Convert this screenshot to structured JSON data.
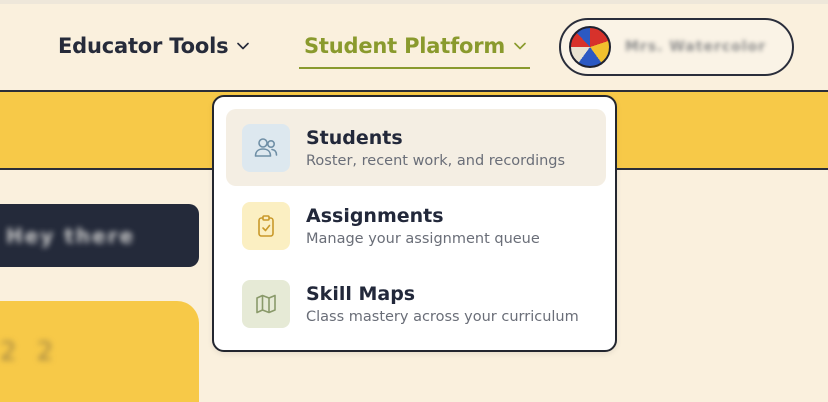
{
  "header": {
    "nav": [
      {
        "label": "Educator Tools",
        "active": false
      },
      {
        "label": "Student Platform",
        "active": true
      }
    ],
    "account": {
      "name": "Mrs. Watercolor"
    }
  },
  "left": {
    "tile_text": "Hey there",
    "card_text": "2 2"
  },
  "dropdown": {
    "items": [
      {
        "title": "Students",
        "subtitle": "Roster, recent work, and recordings",
        "icon": "users-icon",
        "active": true
      },
      {
        "title": "Assignments",
        "subtitle": "Manage your assignment queue",
        "icon": "clipboard-check-icon",
        "active": false
      },
      {
        "title": "Skill Maps",
        "subtitle": "Class mastery across your curriculum",
        "icon": "map-icon",
        "active": false
      }
    ]
  },
  "colors": {
    "accent_green": "#8a9a2d",
    "band_yellow": "#f7c948",
    "background": "#faf0dd",
    "dark": "#242a3a"
  }
}
